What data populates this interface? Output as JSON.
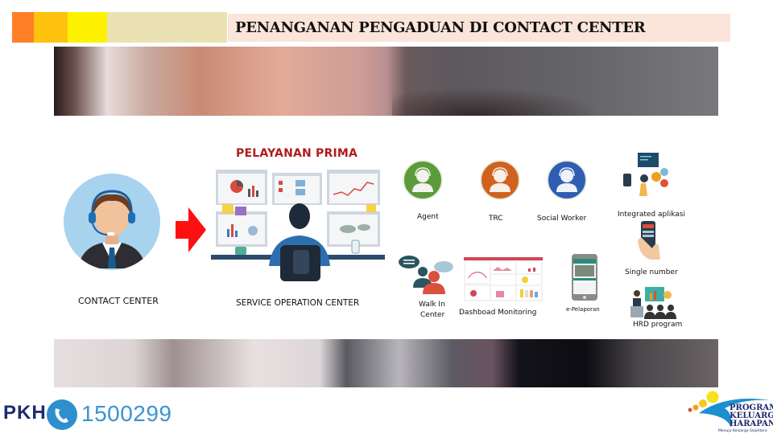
{
  "header": {
    "title": "PENANGANAN PENGADUAN DI CONTACT CENTER",
    "color_blocks": [
      "#ff7f27",
      "#ffc20e",
      "#fff200",
      "#efe4b0"
    ]
  },
  "main": {
    "heading": "PELAYANAN PRIMA",
    "flow": {
      "source_label": "CONTACT CENTER",
      "target_label": "SERVICE OPERATION CENTER",
      "arrow_color": "#ff0000"
    },
    "roles": [
      {
        "label": "Agent",
        "color": "#5b9b3a",
        "icon": "headset-user-icon"
      },
      {
        "label": "TRC",
        "color": "#d0621f",
        "icon": "headset-user-icon"
      },
      {
        "label": "Social Worker",
        "color": "#2f5db3",
        "icon": "headset-user-icon"
      }
    ],
    "channels": [
      {
        "label_lines": [
          "Walk In",
          "Center"
        ],
        "icon": "conversation-icon"
      },
      {
        "label": "Dashboad Monitoring",
        "icon": "dashboard-icon"
      },
      {
        "label": "e-Pelaporan",
        "icon": "mobile-app-icon"
      }
    ],
    "features": [
      {
        "label": "Integrated aplikasi",
        "icon": "integration-icon"
      },
      {
        "label": "Single number",
        "icon": "phone-in-hand-icon"
      },
      {
        "label": "HRD program",
        "icon": "training-presentation-icon"
      }
    ]
  },
  "footer": {
    "brand": "PKH",
    "hotline": "1500299",
    "logo_lines": [
      "PROGRAM",
      "KELUARGA",
      "HARAPAN"
    ],
    "logo_tagline": "Menuju Keluarga Sejahtera"
  }
}
